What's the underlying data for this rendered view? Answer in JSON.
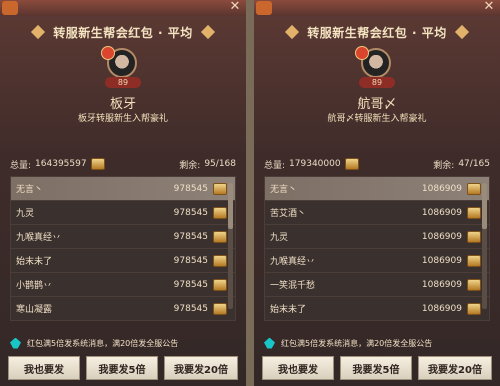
{
  "panels": [
    {
      "title": "转服新生帮会红包 · 平均",
      "level": "89",
      "name": "板牙",
      "subtext": "板牙转服新生入帮豪礼",
      "summary": {
        "total_label": "总量:",
        "total_value": "164395597",
        "remaining_label": "剩余:",
        "remaining_value": "95/168"
      },
      "rows": [
        {
          "name": "无言丶",
          "value": "978545"
        },
        {
          "name": "九灵",
          "value": "978545"
        },
        {
          "name": "九喉真经丷",
          "value": "978545"
        },
        {
          "name": "始末未了",
          "value": "978545"
        },
        {
          "name": "小鹊鹊丷",
          "value": "978545"
        },
        {
          "name": "寒山凝露",
          "value": "978545"
        }
      ],
      "notice": "红包满5倍发系统消息，满20倍发全服公告",
      "buttons": [
        "我也要发",
        "我要发5倍",
        "我要发20倍"
      ]
    },
    {
      "title": "转服新生帮会红包 · 平均",
      "level": "89",
      "name": "航哥〆",
      "subtext": "航哥〆转服新生入帮豪礼",
      "summary": {
        "total_label": "总量:",
        "total_value": "179340000",
        "remaining_label": "剩余:",
        "remaining_value": "47/165"
      },
      "rows": [
        {
          "name": "无言丶",
          "value": "1086909"
        },
        {
          "name": "苦艾酒丶",
          "value": "1086909"
        },
        {
          "name": "九灵",
          "value": "1086909"
        },
        {
          "name": "九喉真经丷",
          "value": "1086909"
        },
        {
          "name": "一笑泯千愁",
          "value": "1086909"
        },
        {
          "name": "始末未了",
          "value": "1086909"
        }
      ],
      "notice": "红包满5倍发系统消息，满20倍发全服公告",
      "buttons": [
        "我也要发",
        "我要发5倍",
        "我要发20倍"
      ]
    }
  ]
}
